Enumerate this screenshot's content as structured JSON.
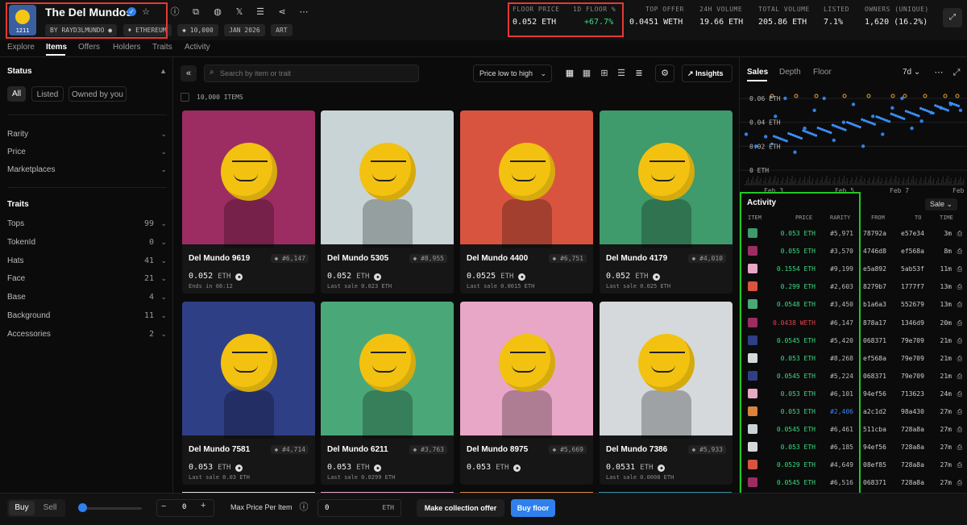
{
  "collection": {
    "name": "The Del Mundos",
    "avatar_badge": "1211",
    "creator": "BY RAYD3LMUNDO",
    "chain": "ETHEREUM",
    "supply": "10,000",
    "date": "JAN 2026",
    "category": "ART"
  },
  "stats": [
    {
      "label": "FLOOR PRICE",
      "value": "0.052 ETH"
    },
    {
      "label": "1D FLOOR %",
      "value": "+67.7%",
      "color": "#3ddc84"
    },
    {
      "label": "TOP OFFER",
      "value": "0.0451 WETH"
    },
    {
      "label": "24H VOLUME",
      "value": "19.66 ETH"
    },
    {
      "label": "TOTAL VOLUME",
      "value": "205.86 ETH"
    },
    {
      "label": "LISTED",
      "value": "7.1%"
    },
    {
      "label": "OWNERS (UNIQUE)",
      "value": "1,620 (16.2%)"
    }
  ],
  "nav_tabs": [
    "Explore",
    "Items",
    "Offers",
    "Holders",
    "Traits",
    "Activity"
  ],
  "sidebar": {
    "status_title": "Status",
    "status_buttons": [
      "All",
      "Listed",
      "Owned by you"
    ],
    "filters": [
      "Rarity",
      "Price",
      "Marketplaces"
    ],
    "traits_title": "Traits",
    "traits": [
      {
        "name": "Tops",
        "count": "99"
      },
      {
        "name": "TokenId",
        "count": "0"
      },
      {
        "name": "Hats",
        "count": "41"
      },
      {
        "name": "Face",
        "count": "21"
      },
      {
        "name": "Base",
        "count": "4"
      },
      {
        "name": "Background",
        "count": "11"
      },
      {
        "name": "Accessories",
        "count": "2"
      }
    ]
  },
  "toolbar": {
    "search_placeholder": "Search by item or trait",
    "sort": "Price low to high",
    "insights": "Insights",
    "items_count": "10,000 ITEMS"
  },
  "cards": [
    {
      "name": "Del Mundo 9619",
      "rank": "#6,147",
      "price": "0.052",
      "unit": "ETH",
      "sub": "Ends in 08:12",
      "bg": "#9c2d62"
    },
    {
      "name": "Del Mundo 5305",
      "rank": "#8,955",
      "price": "0.052",
      "unit": "ETH",
      "sub": "Last sale 0.023 ETH",
      "bg": "#c9d4d6"
    },
    {
      "name": "Del Mundo 4400",
      "rank": "#6,751",
      "price": "0.0525",
      "unit": "ETH",
      "sub": "Last sale 0.0015 ETH",
      "bg": "#d9543e"
    },
    {
      "name": "Del Mundo 4179",
      "rank": "#4,010",
      "price": "0.052",
      "unit": "ETH",
      "sub": "Last sale 0.025 ETH",
      "bg": "#3f9a6c"
    },
    {
      "name": "Del Mundo 7581",
      "rank": "#4,714",
      "price": "0.053",
      "unit": "ETH",
      "sub": "Last sale 0.03 ETH",
      "bg": "#2f3f86"
    },
    {
      "name": "Del Mundo 6211",
      "rank": "#3,763",
      "price": "0.053",
      "unit": "ETH",
      "sub": "Last sale 0.0299 ETH",
      "bg": "#4aa878"
    },
    {
      "name": "Del Mundo 8975",
      "rank": "#5,669",
      "price": "0.053",
      "unit": "ETH",
      "sub": "",
      "bg": "#e8a7c6"
    },
    {
      "name": "Del Mundo 7386",
      "rank": "#5,933",
      "price": "0.0531",
      "unit": "ETH",
      "sub": "Last sale 0.0008 ETH",
      "bg": "#d5d9dc"
    }
  ],
  "right_panel": {
    "tabs": [
      "Sales",
      "Depth",
      "Floor"
    ],
    "range": "7d",
    "activity_title": "Activity",
    "activity_filter": "Sale",
    "headers": [
      "ITEM",
      "PRICE",
      "RARITY",
      "FROM",
      "TO",
      "TIME"
    ]
  },
  "chart_data": {
    "type": "scatter",
    "y_ticks": [
      "0.06 ETH",
      "0.04 ETH",
      "0.02 ETH",
      "0 ETH"
    ],
    "ylim": [
      0,
      0.06
    ],
    "x_ticks": [
      "Feb 3",
      "Feb 5",
      "Feb 7",
      "Feb"
    ],
    "series": [
      {
        "values": [
          0.03,
          0.02,
          0.028,
          0.045,
          0.06,
          0.015,
          0.035,
          0.05,
          0.06,
          0.025,
          0.04,
          0.055,
          0.02,
          0.045,
          0.03,
          0.052,
          0.06,
          0.035,
          0.041,
          0.048,
          0.052,
          0.055,
          0.05
        ]
      }
    ]
  },
  "activity": [
    {
      "price": "0.053 ETH",
      "rarity": "#5,971",
      "from": "78792a",
      "to": "e57e34",
      "time": "3m",
      "color": "#3ddc84",
      "thumb": "#3f9a6c"
    },
    {
      "price": "0.055 ETH",
      "rarity": "#3,570",
      "from": "4746d8",
      "to": "ef568a",
      "time": "8m",
      "color": "#3ddc84",
      "thumb": "#9c2d62"
    },
    {
      "price": "0.1554 ETH",
      "rarity": "#9,199",
      "from": "e5a892",
      "to": "5ab53f",
      "time": "11m",
      "color": "#3ddc84",
      "thumb": "#e8a7c6"
    },
    {
      "price": "0.299 ETH",
      "rarity": "#2,603",
      "from": "8279b7",
      "to": "1777f7",
      "time": "13m",
      "color": "#3ddc84",
      "thumb": "#d9543e"
    },
    {
      "price": "0.0548 ETH",
      "rarity": "#3,450",
      "from": "b1a6a3",
      "to": "552679",
      "time": "13m",
      "color": "#3ddc84",
      "thumb": "#4aa878"
    },
    {
      "price": "0.0438 WETH",
      "rarity": "#6,147",
      "from": "878a17",
      "to": "1346d9",
      "time": "20m",
      "color": "#e0444f",
      "thumb": "#9c2d62"
    },
    {
      "price": "0.0545 ETH",
      "rarity": "#5,420",
      "from": "068371",
      "to": "79e709",
      "time": "21m",
      "color": "#3ddc84",
      "thumb": "#2f3f86"
    },
    {
      "price": "0.053 ETH",
      "rarity": "#8,268",
      "from": "ef568a",
      "to": "79e709",
      "time": "21m",
      "color": "#3ddc84",
      "thumb": "#d5d9dc"
    },
    {
      "price": "0.0545 ETH",
      "rarity": "#5,224",
      "from": "068371",
      "to": "79e709",
      "time": "21m",
      "color": "#3ddc84",
      "thumb": "#2f3f86"
    },
    {
      "price": "0.053 ETH",
      "rarity": "#6,101",
      "from": "94ef56",
      "to": "713623",
      "time": "24m",
      "color": "#3ddc84",
      "thumb": "#e8a7c6"
    },
    {
      "price": "0.053 ETH",
      "rarity": "#2,406",
      "from": "a2c1d2",
      "to": "98a430",
      "time": "27m",
      "color": "#3ddc84",
      "thumb": "#d9843e",
      "rarity_color": "#3b82f6"
    },
    {
      "price": "0.0545 ETH",
      "rarity": "#6,461",
      "from": "511cba",
      "to": "728a8a",
      "time": "27m",
      "color": "#3ddc84",
      "thumb": "#c9d4d6"
    },
    {
      "price": "0.053 ETH",
      "rarity": "#6,185",
      "from": "94ef56",
      "to": "728a8a",
      "time": "27m",
      "color": "#3ddc84",
      "thumb": "#d5d9dc"
    },
    {
      "price": "0.0529 ETH",
      "rarity": "#4,649",
      "from": "08ef85",
      "to": "728a8a",
      "time": "27m",
      "color": "#3ddc84",
      "thumb": "#d9543e"
    },
    {
      "price": "0.0545 ETH",
      "rarity": "#6,516",
      "from": "068371",
      "to": "728a8a",
      "time": "27m",
      "color": "#3ddc84",
      "thumb": "#9c2d62"
    }
  ],
  "bottom_bar": {
    "buy": "Buy",
    "sell": "Sell",
    "quantity": "0",
    "max_price_label": "Max Price Per Item",
    "max_price_value": "0",
    "unit": "ETH",
    "offer_button": "Make collection offer",
    "buy_floor_button": "Buy floor"
  }
}
